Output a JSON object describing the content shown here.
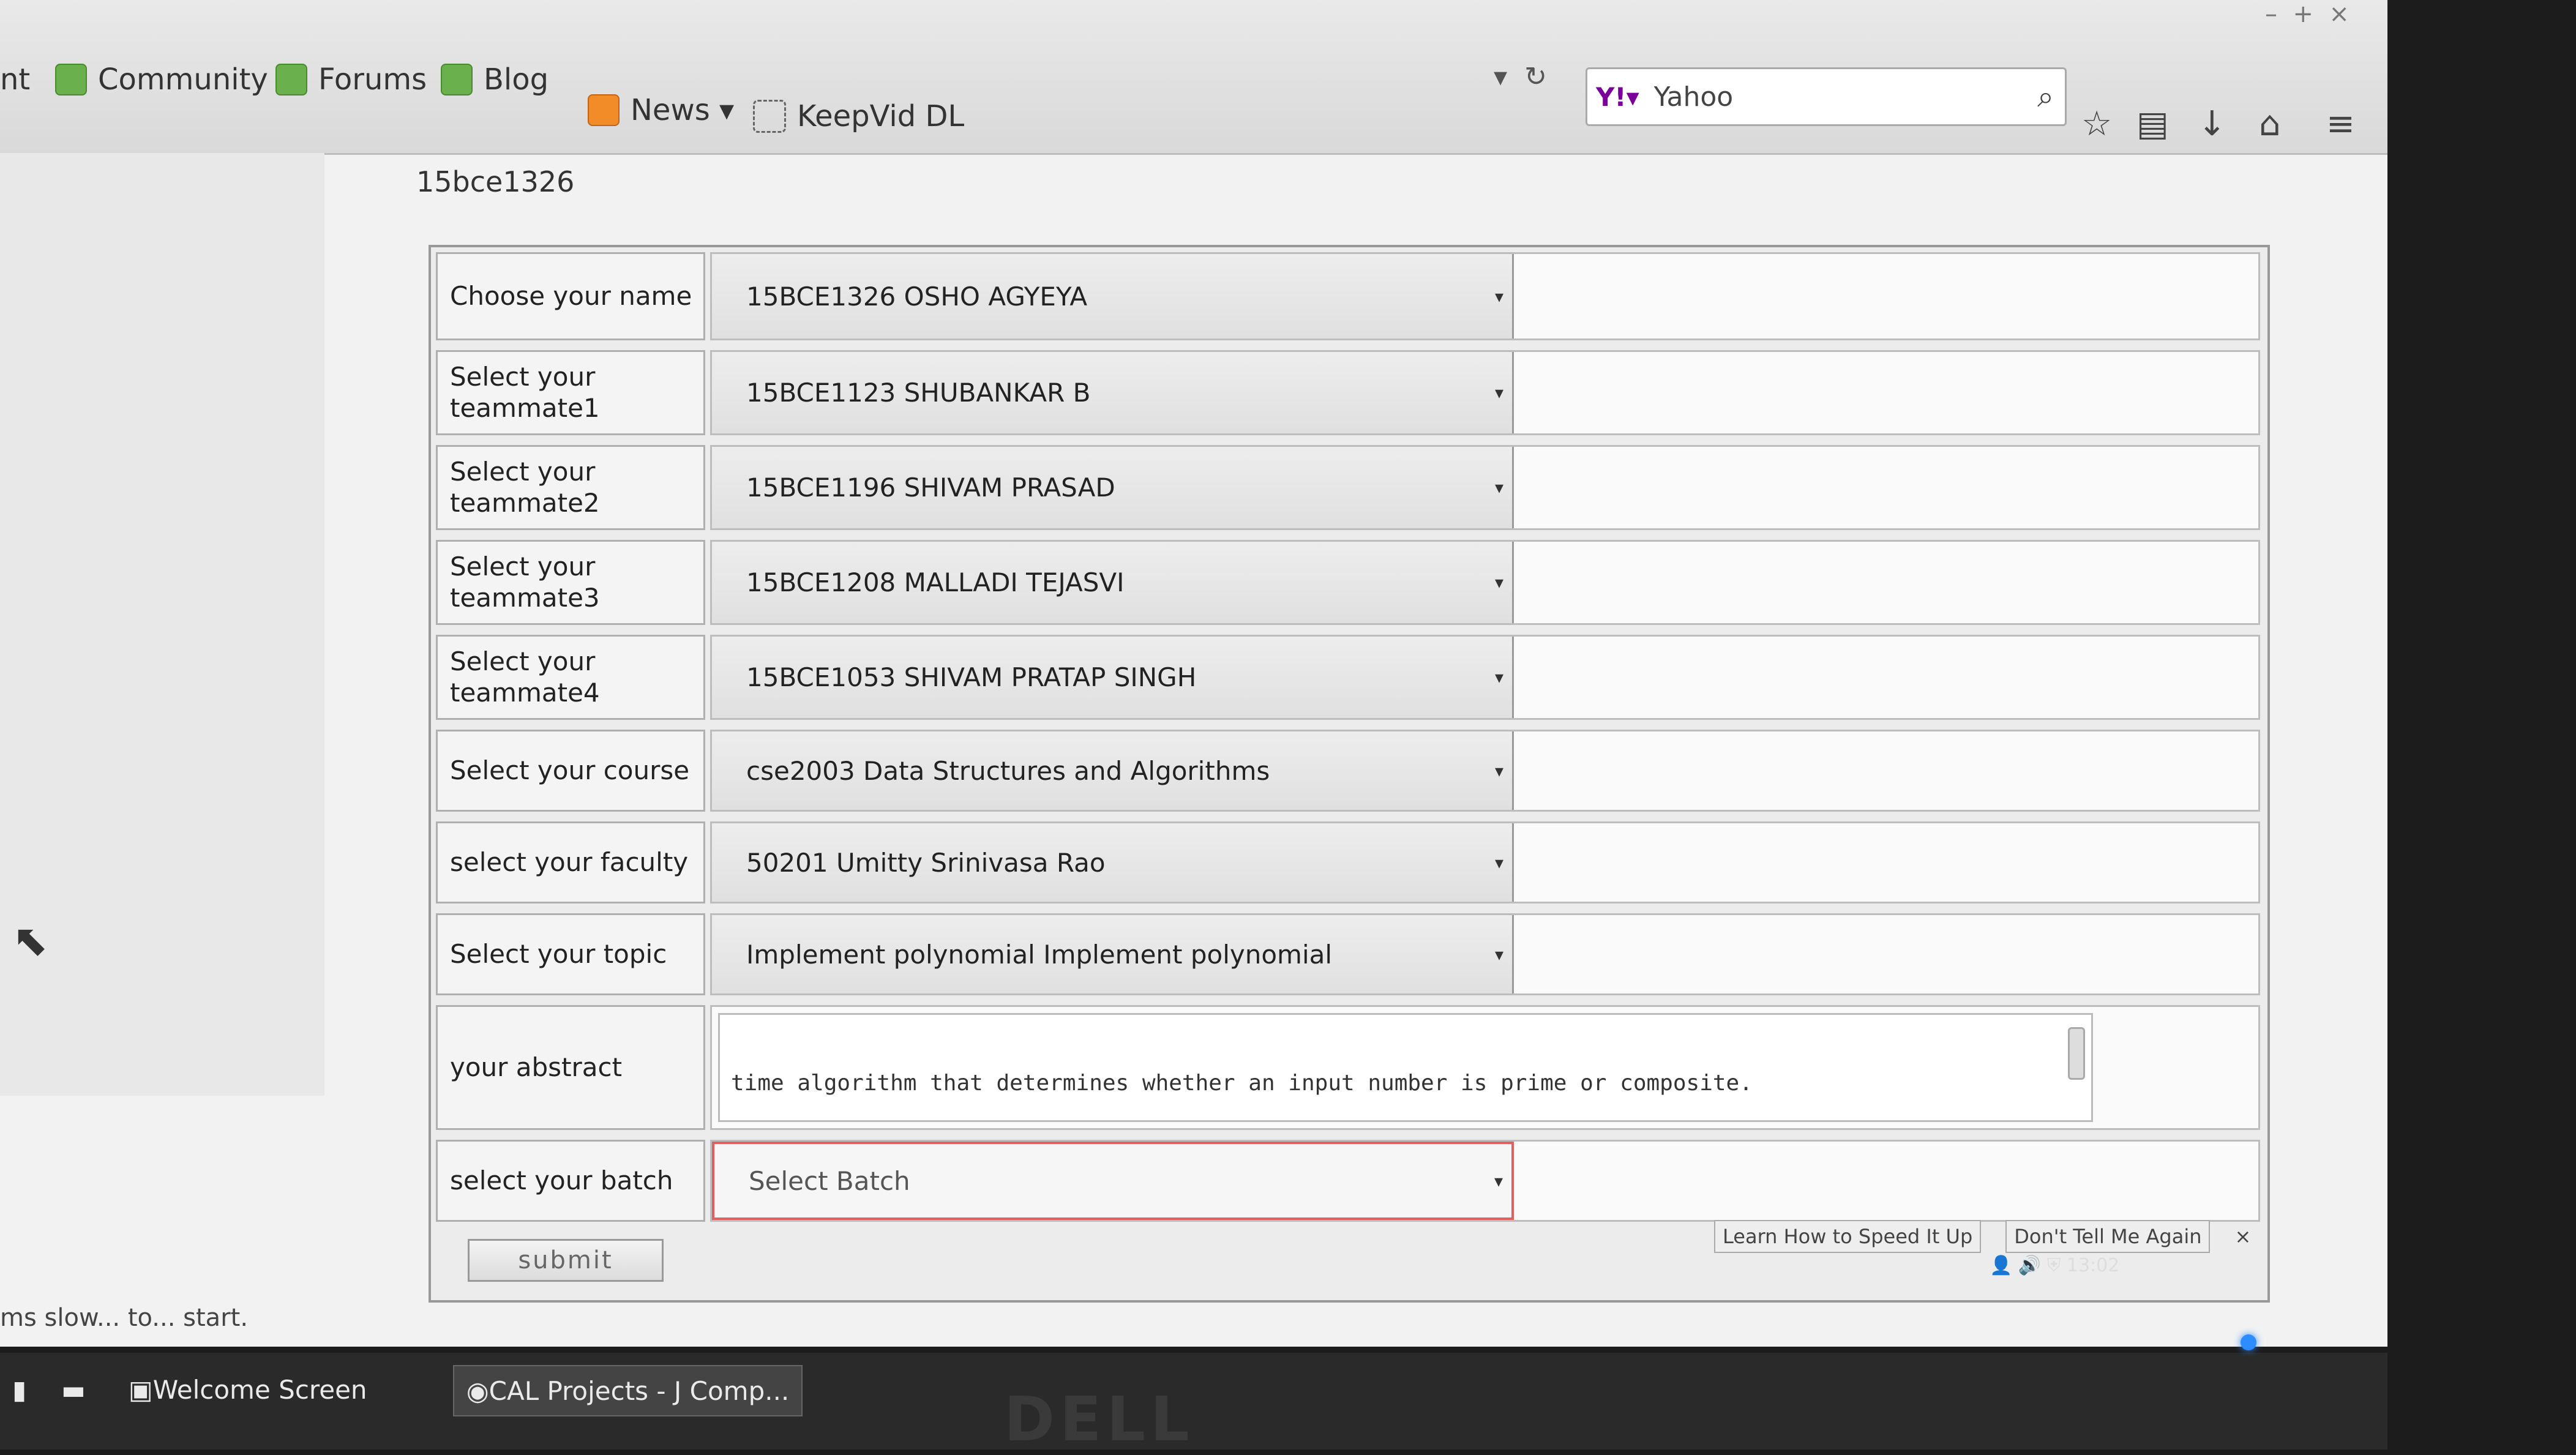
{
  "bookmarks": [
    {
      "label": "nt",
      "icon": "none"
    },
    {
      "label": "Community",
      "icon": "mint-icon"
    },
    {
      "label": "Forums",
      "icon": "mint-icon"
    },
    {
      "label": "Blog",
      "icon": "mint-icon"
    },
    {
      "label": "News ▾",
      "icon": "rss-icon"
    },
    {
      "label": "KeepVid DL",
      "icon": "bookmark-icon"
    }
  ],
  "search": {
    "engine_badge": "Y!▾",
    "value": "Yahoo"
  },
  "page": {
    "user_id": "15bce1326"
  },
  "form": {
    "rows": [
      {
        "label": "Choose your name",
        "value": "15BCE1326 OSHO AGYEYA"
      },
      {
        "label": "Select your teammate1",
        "value": "15BCE1123 SHUBANKAR B"
      },
      {
        "label": "Select your teammate2",
        "value": "15BCE1196 SHIVAM PRASAD"
      },
      {
        "label": "Select your teammate3",
        "value": "15BCE1208 MALLADI TEJASVI"
      },
      {
        "label": "Select your teammate4",
        "value": "15BCE1053 SHIVAM PRATAP SINGH"
      },
      {
        "label": "Select your course",
        "value": "cse2003 Data Structures and Algorithms"
      },
      {
        "label": "select your faculty",
        "value": "50201 Umitty Srinivasa Rao"
      },
      {
        "label": "Select your topic",
        "value": "Implement polynomial Implement polynomial"
      }
    ],
    "abstract_label": "your abstract",
    "abstract_value": "time algorithm that determines whether an input number is prime or composite.",
    "batch_label": "select your batch",
    "batch_value": "Select Batch",
    "submit_label": "submit"
  },
  "notice": {
    "learn": "Learn How to Speed It Up",
    "dont": "Don't Tell Me Again",
    "close": "×"
  },
  "status": "ms slow... to... start.",
  "taskbar": {
    "item1": "Welcome Screen",
    "item2": "CAL Projects - J Comp..."
  },
  "tray": {
    "time": "13:02"
  },
  "brand": "DELL"
}
